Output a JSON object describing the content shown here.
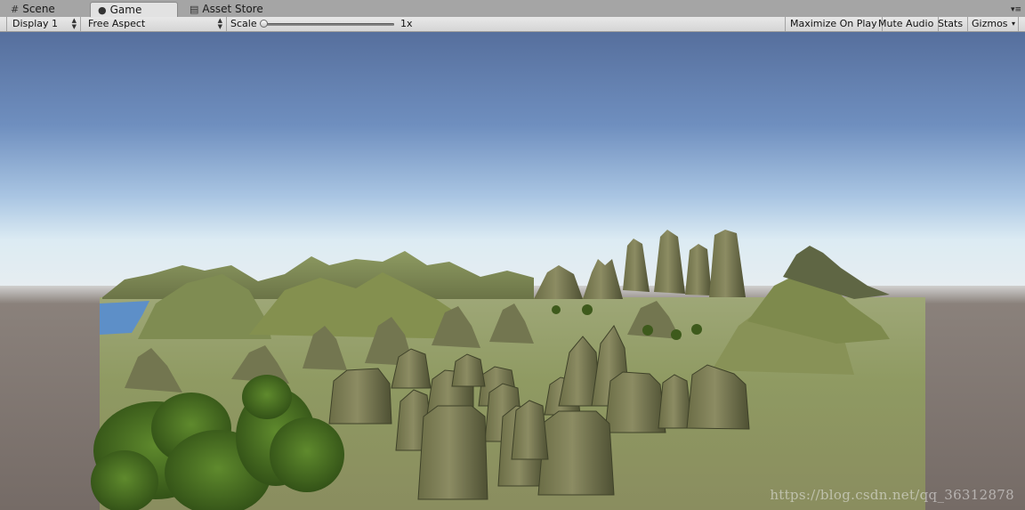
{
  "tabs": [
    {
      "label": "Scene",
      "icon": "grid-icon",
      "active": false
    },
    {
      "label": "Game",
      "icon": "pacman-icon",
      "active": true
    },
    {
      "label": "Asset Store",
      "icon": "store-icon",
      "active": false
    }
  ],
  "toolbar": {
    "display": "Display 1",
    "aspect": "Free Aspect",
    "scale_label": "Scale",
    "scale_value": "1x",
    "maximize_on_play": "Maximize On Play",
    "mute_audio": "Mute Audio",
    "stats": "Stats",
    "gizmos": "Gizmos"
  },
  "viewport": {
    "watermark": "https://blog.csdn.net/qq_36312878"
  },
  "colors": {
    "tab_bg": "#a5a5a5",
    "toolbar_bg": "#dcdcdc",
    "sky_top": "#5b77a6",
    "sky_horizon": "#cfe0ee",
    "ground": "#8b9a5c",
    "letterbox": "#7d746e"
  }
}
